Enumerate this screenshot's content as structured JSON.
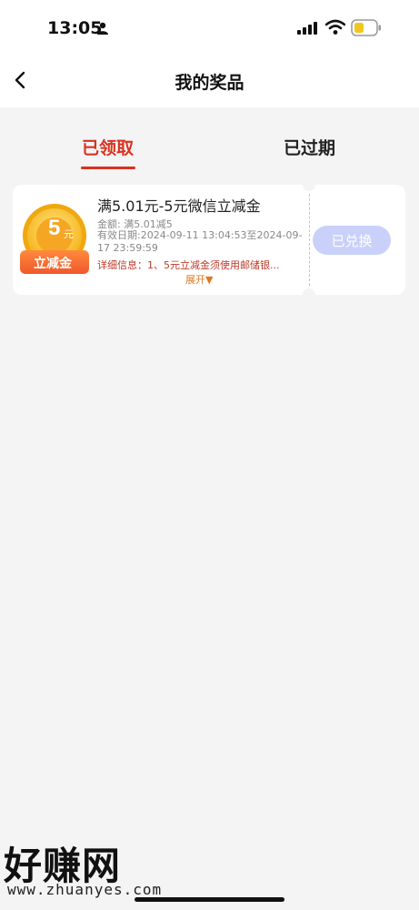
{
  "status_bar": {
    "time": "13:05"
  },
  "nav": {
    "title": "我的奖品"
  },
  "tabs": [
    {
      "label": "已领取",
      "active": true
    },
    {
      "label": "已过期",
      "active": false
    }
  ],
  "coupon": {
    "badge_value": "5",
    "badge_unit": "元",
    "badge_label": "立减金",
    "title": "满5.01元-5元微信立减金",
    "amount": "金额: 满5.01减5",
    "validity": "有效日期:2024-09-11 13:04:53至2024-09-17 23:59:59",
    "detail": "详细信息：1、5元立减金须使用邮储银...",
    "expand_label": "展开▼",
    "button_label": "已兑换"
  },
  "watermark": {
    "main": "好赚网",
    "url": "www.zhuanyes.com"
  },
  "colors": {
    "accent": "#d9321f",
    "button_disabled": "#c9d1fb",
    "background": "#f4f4f4"
  }
}
